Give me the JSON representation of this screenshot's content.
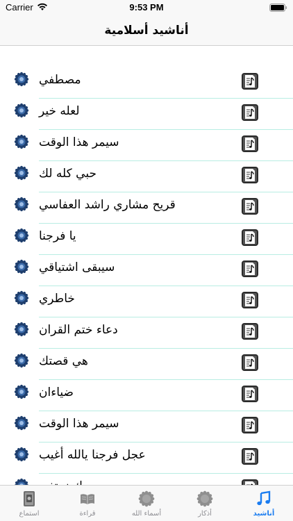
{
  "status": {
    "carrier": "Carrier",
    "time": "9:53 PM"
  },
  "nav": {
    "title": "أناشيد أسلامية"
  },
  "items": [
    {
      "title": "مصطفي"
    },
    {
      "title": "لعله خير"
    },
    {
      "title": "سيمر هذا الوقت"
    },
    {
      "title": "حبي كله لك"
    },
    {
      "title": "قريح مشاري راشد العفاسي"
    },
    {
      "title": "يا فرجنا"
    },
    {
      "title": "سيبقى اشتياقي"
    },
    {
      "title": "خاطري"
    },
    {
      "title": "دعاء ختم القران"
    },
    {
      "title": "هي قصتك"
    },
    {
      "title": "ضياءان"
    },
    {
      "title": "سيمر هذا الوقت"
    },
    {
      "title": "عجل فرجنا يالله أغيب"
    },
    {
      "title": "بك نحتفي"
    }
  ],
  "tabs": [
    {
      "label": "استماع",
      "icon": "quran-book-icon"
    },
    {
      "label": "قراءة",
      "icon": "open-book-icon"
    },
    {
      "label": "أسماء الله",
      "icon": "rosette-icon"
    },
    {
      "label": "أذكار",
      "icon": "rosette-icon"
    },
    {
      "label": "أناشيد",
      "icon": "music-note-icon",
      "active": true
    }
  ],
  "colors": {
    "accent": "#1a7cf0",
    "separator": "#b8ede3",
    "rosette": "#1f3f6e"
  }
}
